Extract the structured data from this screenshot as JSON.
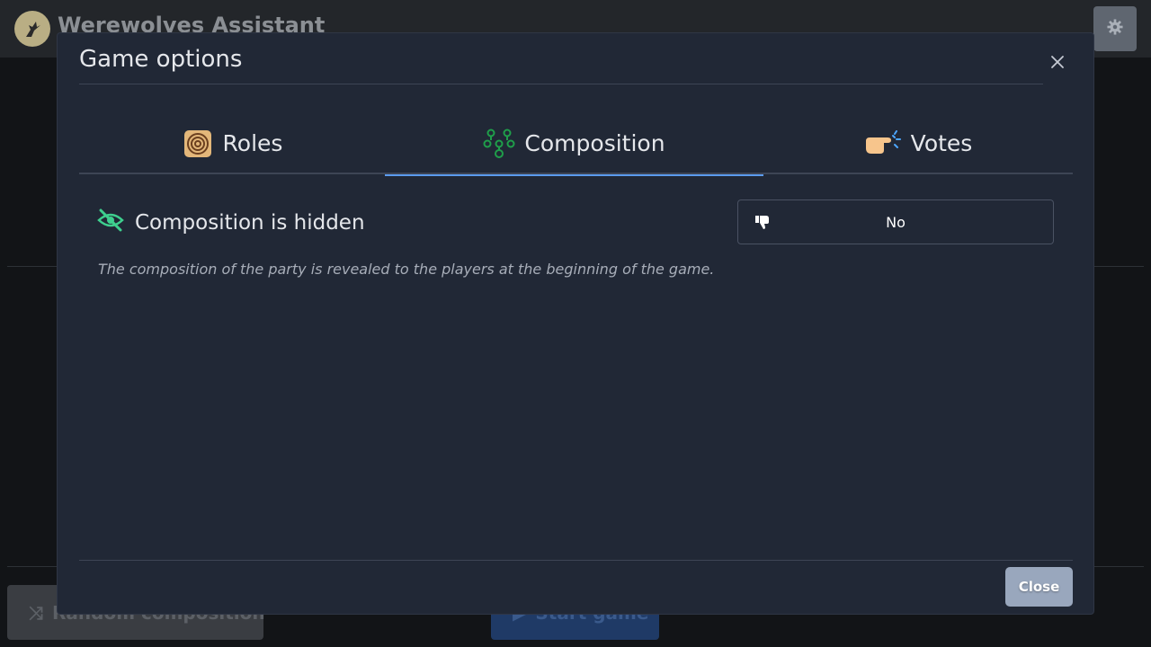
{
  "app": {
    "title": "Werewolves Assistant",
    "logo_icon": "wolf-howl-icon",
    "settings_icon": "gear-icon"
  },
  "background_buttons": {
    "random_label": "Random composition",
    "start_label": "Start game"
  },
  "modal": {
    "title": "Game options",
    "close_icon": "close-icon",
    "tabs": [
      {
        "label": "Roles",
        "icon": "spiral-icon",
        "active": false
      },
      {
        "label": "Composition",
        "icon": "people-group-icon",
        "active": true
      },
      {
        "label": "Votes",
        "icon": "pointing-hand-icon",
        "active": false
      }
    ],
    "option": {
      "label": "Composition is hidden",
      "icon": "eye-slash-icon",
      "value_label": "No",
      "value_icon": "thumbs-down-icon",
      "description": "The composition of the party is revealed to the players at the beginning of the game."
    },
    "close_label": "Close"
  },
  "colors": {
    "accent": "#5b9bef",
    "option_icon": "#3ecf8e",
    "close_button": "#99a7bd"
  }
}
